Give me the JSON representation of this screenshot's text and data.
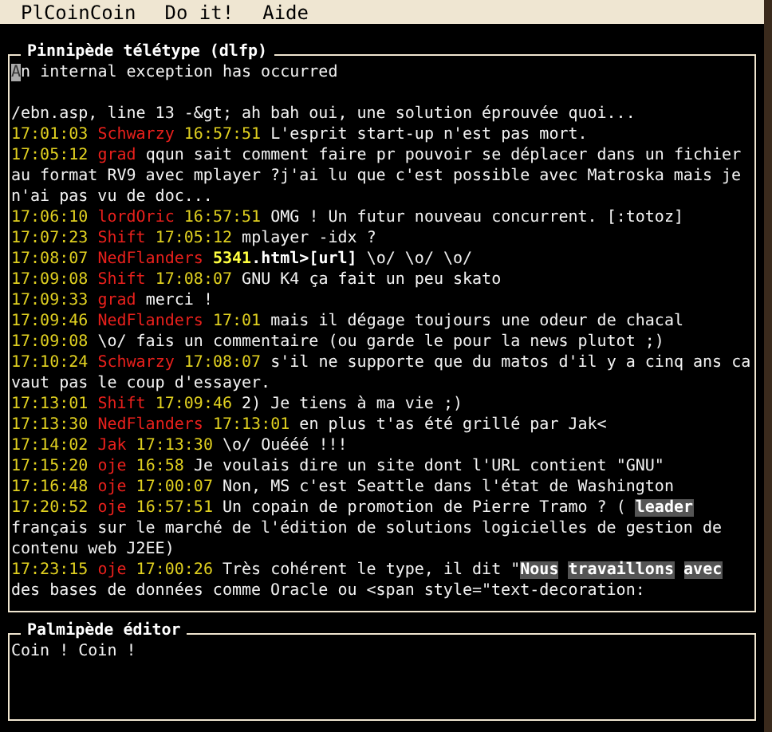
{
  "menu": [
    {
      "label": "PlCoinCoin"
    },
    {
      "label": "Do it!"
    },
    {
      "label": "Aide"
    }
  ],
  "teletype": {
    "title": "Pinnipède télétype (dlfp)",
    "lines": [
      {
        "kind": "plain",
        "parts": [
          {
            "kind": "cursor",
            "text": "A"
          },
          {
            "kind": "plain",
            "text": "n internal exception has occurred"
          }
        ]
      },
      {
        "kind": "blank"
      },
      {
        "kind": "plain",
        "parts": [
          {
            "kind": "plain",
            "text": "/ebn.asp, line 13 -&gt; ah bah oui, une solution éprouvée quoi..."
          }
        ]
      },
      {
        "kind": "post",
        "time": "17:01:03",
        "login": "Schwarzy",
        "ref": "16:57:51",
        "parts": [
          {
            "kind": "plain",
            "text": "L'esprit start-up n'est pas mort."
          }
        ]
      },
      {
        "kind": "post",
        "time": "17:05:12",
        "login": "grad",
        "parts": [
          {
            "kind": "plain",
            "text": "qqun sait comment faire pr pouvoir se déplacer dans un fichier au format RV9 avec mplayer ?j'ai lu que c'est possible avec Matroska mais je n'ai pas vu de doc..."
          }
        ]
      },
      {
        "kind": "post",
        "time": "17:06:10",
        "login": "lordOric",
        "ref": "16:57:51",
        "parts": [
          {
            "kind": "plain",
            "text": "OMG ! Un futur nouveau concurrent. [:totoz]"
          }
        ]
      },
      {
        "kind": "post",
        "time": "17:07:23",
        "login": "Shift",
        "ref": "17:05:12",
        "parts": [
          {
            "kind": "plain",
            "text": "mplayer -idx ?"
          }
        ]
      },
      {
        "kind": "post",
        "time": "17:08:07",
        "login": "NedFlanders",
        "parts": [
          {
            "kind": "bold-yellow",
            "text": "5341"
          },
          {
            "kind": "bold",
            "text": ".html>[url]"
          },
          {
            "kind": "plain",
            "text": " \\o/ \\o/ \\o/"
          }
        ]
      },
      {
        "kind": "post",
        "time": "17:09:08",
        "login": "Shift",
        "ref": "17:08:07",
        "parts": [
          {
            "kind": "plain",
            "text": "GNU K4 ça fait un peu skato"
          }
        ]
      },
      {
        "kind": "post",
        "time": "17:09:33",
        "login": "grad",
        "parts": [
          {
            "kind": "plain",
            "text": "merci !"
          }
        ]
      },
      {
        "kind": "post",
        "time": "17:09:46",
        "login": "NedFlanders",
        "ref": "17:01",
        "parts": [
          {
            "kind": "plain",
            "text": "mais il dégage toujours une odeur de chacal"
          }
        ]
      },
      {
        "kind": "post",
        "time": "17:09:08",
        "parts": [
          {
            "kind": "plain",
            "text": "\\o/ fais un commentaire (ou garde le pour la news plutot ;)"
          }
        ]
      },
      {
        "kind": "post",
        "time": "17:10:24",
        "login": "Schwarzy",
        "ref": "17:08:07",
        "parts": [
          {
            "kind": "plain",
            "text": "s'il ne supporte que du matos d'il y a cinq ans ca vaut pas le coup d'essayer."
          }
        ]
      },
      {
        "kind": "post",
        "time": "17:13:01",
        "login": "Shift",
        "ref": "17:09:46",
        "parts": [
          {
            "kind": "plain",
            "text": "2) Je tiens à ma vie ;)"
          }
        ]
      },
      {
        "kind": "post",
        "time": "17:13:30",
        "login": "NedFlanders",
        "ref": "17:13:01",
        "parts": [
          {
            "kind": "plain",
            "text": "en plus t'as été grillé par Jak<"
          }
        ]
      },
      {
        "kind": "post",
        "time": "17:14:02",
        "login": "Jak",
        "ref": "17:13:30",
        "parts": [
          {
            "kind": "plain",
            "text": "\\o/ Ouééé !!!"
          }
        ]
      },
      {
        "kind": "post",
        "time": "17:15:20",
        "login": "oje",
        "ref": "16:58",
        "parts": [
          {
            "kind": "plain",
            "text": "Je voulais dire un site dont l'URL contient \"GNU\""
          }
        ]
      },
      {
        "kind": "post",
        "time": "17:16:48",
        "login": "oje",
        "ref": "17:00:07",
        "parts": [
          {
            "kind": "plain",
            "text": "Non, MS c'est Seattle dans l'état de Washington"
          }
        ]
      },
      {
        "kind": "post",
        "time": "17:20:52",
        "login": "oje",
        "ref": "16:57:51",
        "parts": [
          {
            "kind": "plain",
            "text": "Un copain de promotion de Pierre Tramo ? ( "
          },
          {
            "kind": "highlight",
            "text": "leader"
          },
          {
            "kind": "plain",
            "text": " français sur le marché de l'édition de solutions logicielles de gestion de contenu web J2EE)"
          }
        ]
      },
      {
        "kind": "post",
        "time": "17:23:15",
        "login": "oje",
        "ref": "17:00:26",
        "parts": [
          {
            "kind": "plain",
            "text": "Très cohérent le type, il dit \""
          },
          {
            "kind": "highlight",
            "text": "Nous travaillons avec"
          },
          {
            "kind": "plain",
            "text": " des bases de données comme Oracle ou <span style=\"text-decoration:"
          }
        ]
      }
    ]
  },
  "editor": {
    "title": "Palmipède éditor",
    "value": "Coin ! Coin !"
  }
}
